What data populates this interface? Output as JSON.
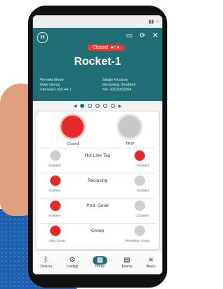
{
  "header": {
    "logo": "H",
    "status_label": "Closed",
    "device_title": "Rocket-1",
    "icons": [
      "battery-icon",
      "refresh-icon",
      "close-icon"
    ],
    "info_left": [
      "Remote Mode",
      "Main Group",
      "Firmware v01.44.2"
    ],
    "info_right": [
      "Single Reclose",
      "Reclosing: Enabled",
      "SN: 4102063964"
    ]
  },
  "pager": {
    "prev": "◀",
    "next": "▶"
  },
  "main": {
    "close_label": "Closed",
    "trip_label": "TRIP"
  },
  "rows": [
    {
      "name": "Hot Line Tag",
      "left": "Enabled",
      "right": "Disabled"
    },
    {
      "name": "Reclosing",
      "left": "Enabled",
      "right": "Disabled"
    },
    {
      "name": "Prot. Geral",
      "left": "Enabled",
      "right": "Disabled"
    },
    {
      "name": "Group",
      "left": "Main Group",
      "right": "Alternative Group"
    }
  ],
  "nav": [
    {
      "label": "Devices",
      "icon": "bluetooth-icon"
    },
    {
      "label": "Configs",
      "icon": "gear-icon"
    },
    {
      "label": "Home",
      "icon": "grid-icon"
    },
    {
      "label": "Events",
      "icon": "calendar-icon"
    },
    {
      "label": "Menu",
      "icon": "menu-icon"
    }
  ],
  "colors": {
    "accent": "#1e6e73",
    "red": "#e52a2a",
    "grey": "#c8c8c8"
  }
}
